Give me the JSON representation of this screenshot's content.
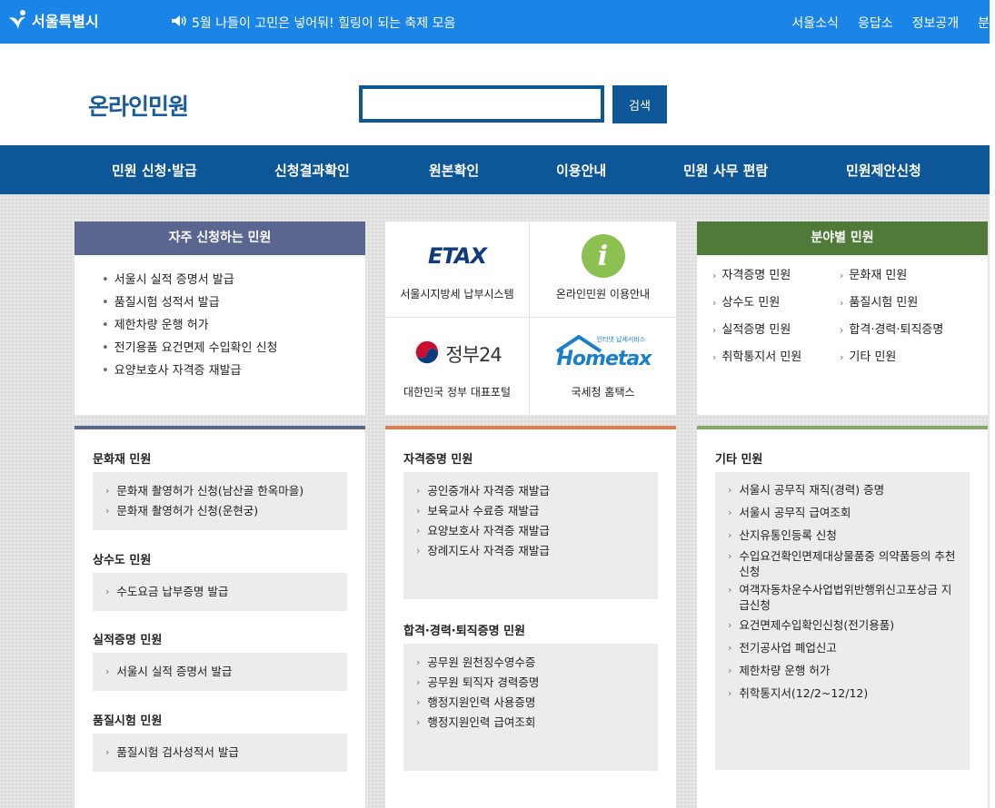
{
  "top": {
    "logo_text": "서울특별시",
    "notice": "5월 나들이 고민은 넣어둬! 힐링이 되는 축제 모음",
    "links": [
      "서울소식",
      "응답소",
      "정보공개",
      "분"
    ]
  },
  "header": {
    "title": "온라인민원",
    "search_button": "검색",
    "search_value": ""
  },
  "nav": [
    "민원 신청·발급",
    "신청결과확인",
    "원본확인",
    "이용안내",
    "민원 사무 편람",
    "민원제안신청"
  ],
  "frequent": {
    "title": "자주 신청하는 민원",
    "items": [
      "서울시 실적 증명서 발급",
      "품질시험 성적서 발급",
      "제한차량 운행 허가",
      "전기용품 요건면제 수입확인 신청",
      "요양보호사 자격증 재발급"
    ]
  },
  "shortcuts": [
    {
      "logo": "ETAX",
      "label": "서울시지방세 납부시스템"
    },
    {
      "logo": "i",
      "label": "온라인민원 이용안내"
    },
    {
      "logo": "정부24",
      "label": "대한민국 정부 대표포털"
    },
    {
      "logo": "Hometax",
      "logo_small": "인터넷 납세서비스",
      "label": "국세청 홈택스"
    }
  ],
  "field": {
    "title": "분야별 민원",
    "items": [
      "자격증명 민원",
      "문화재 민원",
      "상수도 민원",
      "품질시험 민원",
      "실적증명 민원",
      "합격·경력·퇴직증명",
      "취학통지서 민원",
      "기타 민원"
    ]
  },
  "sections": {
    "culture": {
      "title": "문화재 민원",
      "items": [
        "문화재 촬영허가 신청(남산골 한옥마을)",
        "문화재 촬영허가 신청(운현궁)"
      ]
    },
    "water": {
      "title": "상수도 민원",
      "items": [
        "수도요금 납부증명 발급"
      ]
    },
    "perf": {
      "title": "실적증명 민원",
      "items": [
        "서울시 실적 증명서 발급"
      ]
    },
    "quality": {
      "title": "품질시험 민원",
      "items": [
        "품질시험 검사성적서 발급"
      ]
    },
    "cert": {
      "title": "자격증명 민원",
      "items": [
        "공인중개사 자격증 재발급",
        "보육교사 수료증 재발급",
        "요양보호사 자격증 재발급",
        "장례지도사 자격증 재발급"
      ]
    },
    "career": {
      "title": "합격·경력·퇴직증명 민원",
      "items": [
        "공무원 원천징수영수증",
        "공무원 퇴직자 경력증명",
        "행정지원인력 사용증명",
        "행정지원인력 급여조회"
      ]
    },
    "etc": {
      "title": "기타 민원",
      "items": [
        "서울시 공무직 재직(경력) 증명",
        "서울시 공무직 급여조회",
        "산지유통인등록 신청",
        "수입요건확인면제대상물품중 의약품등의 추천신청",
        "여객자동차운수사업법위반행위신고포상금 지급신청",
        "요건면제수입확인신청(전기용품)",
        "전기공사업 폐업신고",
        "제한차량 운행 허가",
        "취학통지서(12/2~12/12)"
      ]
    }
  },
  "colors": {
    "topbar": "#1a85e6",
    "nav": "#0d5698",
    "freq_header": "#5a6690",
    "field_header": "#4f7a39",
    "mid_accent": "#e07b4a",
    "right_accent": "#86a765"
  }
}
